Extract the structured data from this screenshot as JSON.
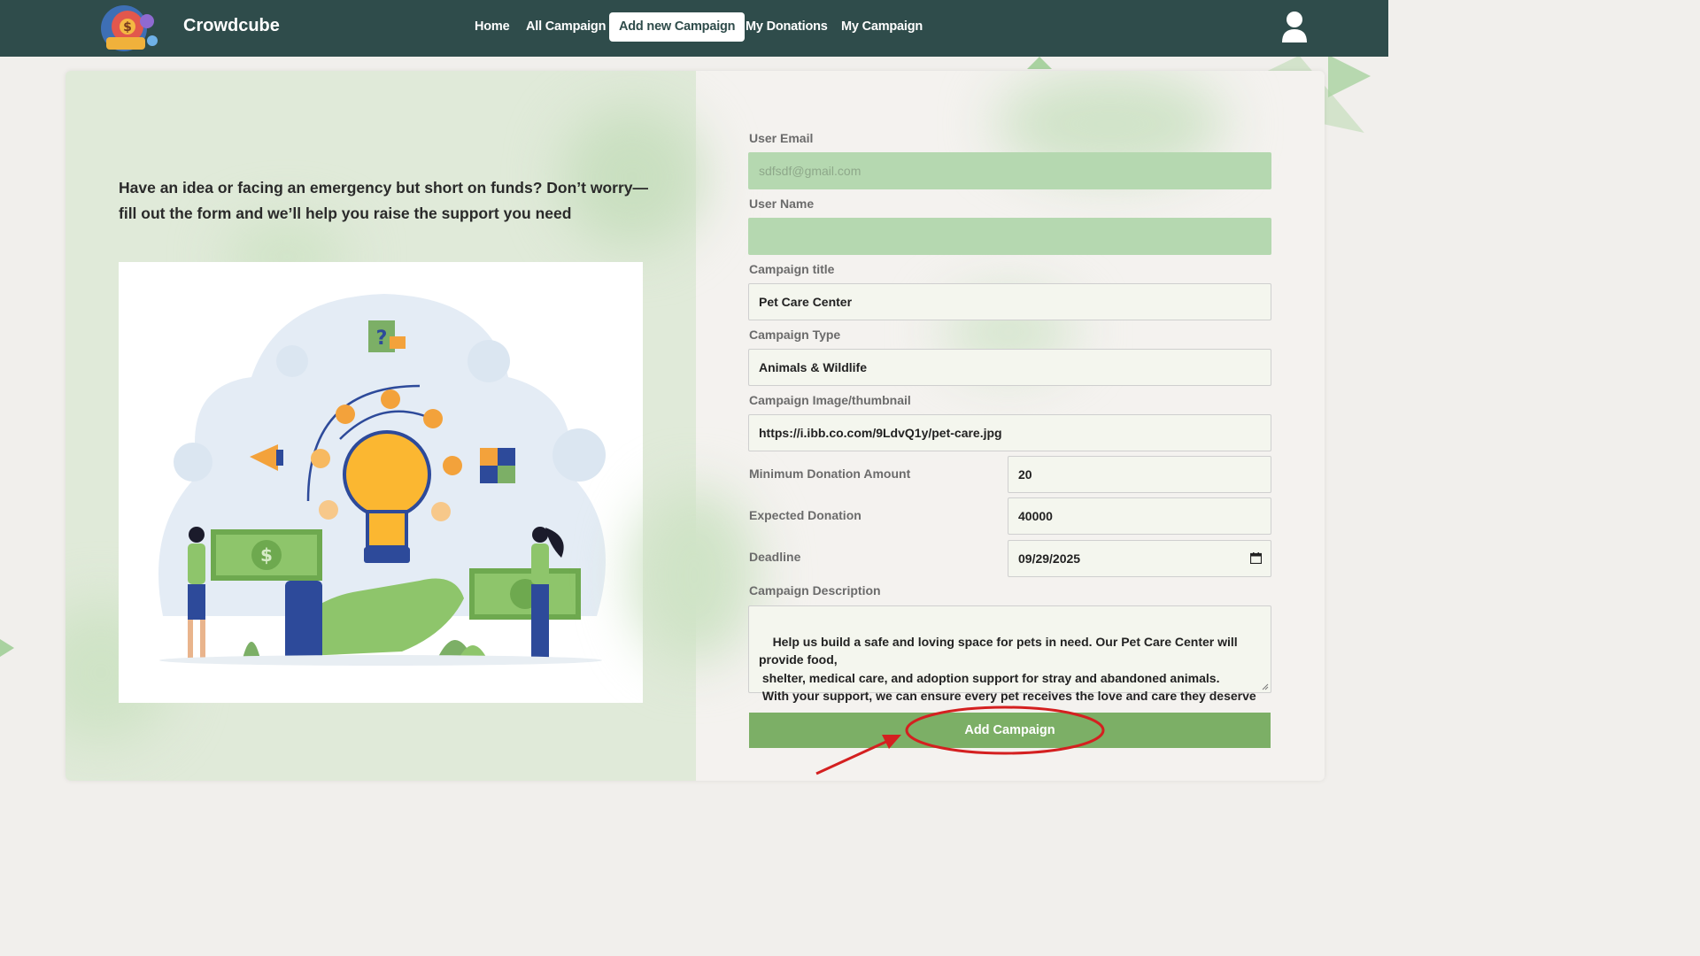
{
  "nav": {
    "brand": "Crowdcube",
    "links": [
      "Home",
      "All Campaign",
      "Add new Campaign",
      "My Donations",
      "My Campaign"
    ],
    "active_index": 2
  },
  "intro": {
    "text": "Have an idea or facing an emergency but short on funds? Don’t worry—fill out the form and we’ll help you raise the support you need"
  },
  "form": {
    "user_email_label": "User Email",
    "user_email_placeholder": "sdfsdf@gmail.com",
    "user_name_label": "User Name",
    "user_name_value": "",
    "title_label": "Campaign title",
    "title_value": "Pet Care Center",
    "type_label": "Campaign Type",
    "type_value": "Animals & Wildlife",
    "image_label": "Campaign Image/thumbnail",
    "image_value": "https://i.ibb.co.com/9LdvQ1y/pet-care.jpg",
    "min_label": "Minimum Donation Amount",
    "min_value": "20",
    "expected_label": "Expected Donation",
    "expected_value": "40000",
    "deadline_label": "Deadline",
    "deadline_value": "09/29/2025",
    "desc_label": "Campaign Description",
    "desc_value": "Help us build a safe and loving space for pets in need. Our Pet Care Center will provide food,\n shelter, medical care, and adoption support for stray and abandoned animals.\n With your support, we can ensure every pet receives the love and care they deserve",
    "submit_label": "Add Campaign"
  },
  "colors": {
    "navbar": "#2f4c4b",
    "accent_green": "#7caf66",
    "disabled_field": "#b5d8b0",
    "annotation_red": "#d42020"
  },
  "icons": {
    "logo": "crowdcube-logo",
    "user": "user-icon",
    "calendar": "calendar-icon"
  }
}
